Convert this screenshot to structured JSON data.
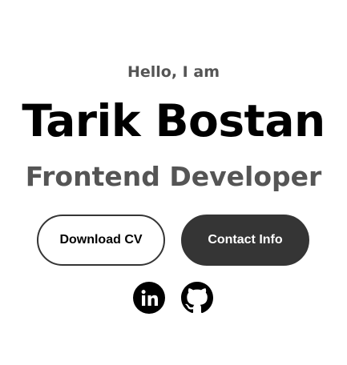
{
  "hero": {
    "greeting": "Hello, I am",
    "name": "Tarik Bostan",
    "role": "Frontend Developer"
  },
  "buttons": {
    "download_cv": "Download CV",
    "contact_info": "Contact Info"
  },
  "social": {
    "icons": [
      "linkedin-icon",
      "github-icon"
    ]
  },
  "colors": {
    "text_primary": "#000000",
    "text_secondary": "#555555",
    "button_dark": "#353535",
    "background": "#ffffff"
  }
}
